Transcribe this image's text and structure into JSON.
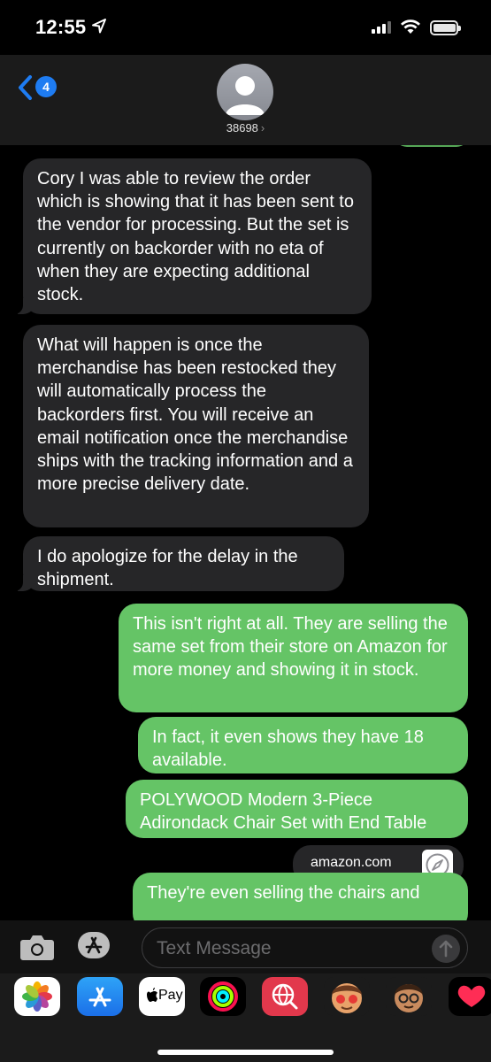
{
  "status_bar": {
    "time": "12:55",
    "icons": [
      "location-arrow-icon",
      "signal-icon",
      "wifi-icon",
      "battery-icon"
    ]
  },
  "header": {
    "back_badge": "4",
    "contact": "38698",
    "contact_chevron": "›"
  },
  "messages": [
    {
      "direction": "incoming",
      "text": "Cory I was able to review the order which is showing that it has been sent to the vendor for processing. But the set is currently on backorder with no eta of when they are expecting additional stock."
    },
    {
      "direction": "incoming",
      "text": "What will happen is once the merchandise has been restocked they will automatically process the backorders first.  You will receive an email notification once the merchandise ships with the tracking information and a more precise delivery date."
    },
    {
      "direction": "incoming",
      "text": "I do apologize for the delay in the shipment."
    },
    {
      "direction": "outgoing",
      "text": "This isn't right at all. They are selling the same set from their store on Amazon for more money and showing it in stock."
    },
    {
      "direction": "outgoing",
      "text": "In fact, it even shows they have 18 available."
    },
    {
      "direction": "outgoing",
      "text": "POLYWOOD Modern 3-Piece Adirondack Chair Set with End Table"
    },
    {
      "direction": "incoming-link",
      "text": "amazon.com",
      "icon": "compass-icon"
    },
    {
      "direction": "outgoing",
      "text": "They're even selling the chairs and"
    }
  ],
  "input": {
    "placeholder": "Text Message"
  },
  "app_drawer": {
    "apps": [
      "photos-app-icon",
      "app-store-icon",
      "apple-pay-icon",
      "activity-icon",
      "search-globe-icon",
      "memoji-stickers-icon",
      "memoji-icon",
      "digital-touch-icon"
    ],
    "apple_pay_label": "Pay"
  },
  "colors": {
    "incoming_bubble": "#262628",
    "outgoing_bubble": "#65c466",
    "accent_blue": "#1e7cf2",
    "background": "#000000"
  }
}
